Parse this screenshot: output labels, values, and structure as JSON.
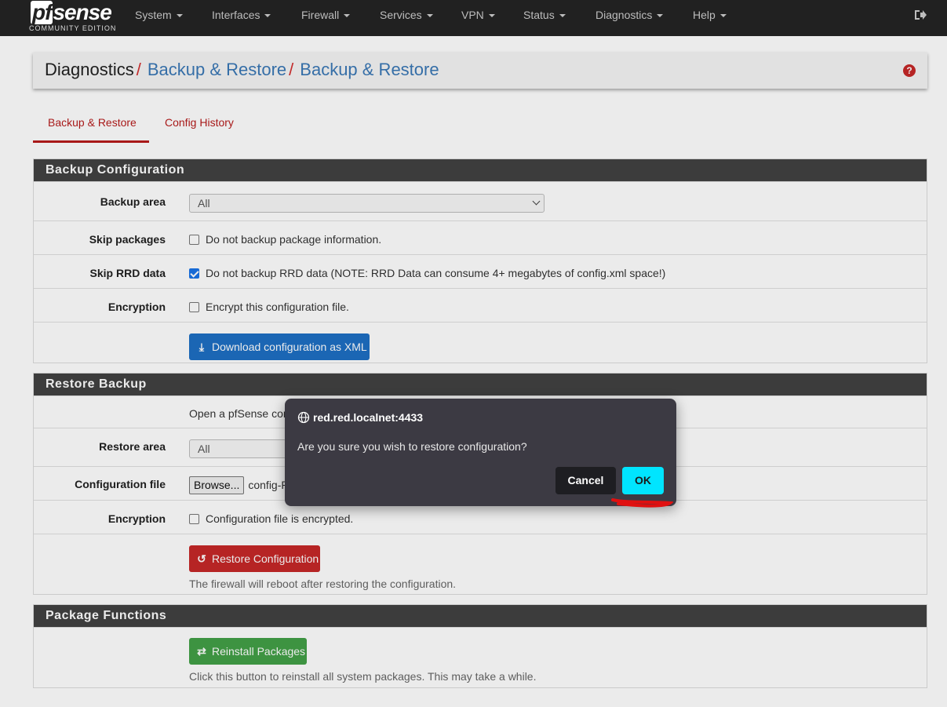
{
  "navbar": {
    "logo_main": "sense",
    "logo_pf": "pf",
    "logo_sub": "COMMUNITY EDITION",
    "items": [
      "System",
      "Interfaces",
      "Firewall",
      "Services",
      "VPN",
      "Status",
      "Diagnostics",
      "Help"
    ]
  },
  "breadcrumb": {
    "first": "Diagnostics",
    "separator": "/",
    "second": "Backup & Restore",
    "third": "Backup & Restore"
  },
  "help_icon": "?",
  "tabs": [
    {
      "label": "Backup & Restore",
      "active": true
    },
    {
      "label": "Config History",
      "active": false
    }
  ],
  "backup": {
    "heading": "Backup Configuration",
    "area_label": "Backup area",
    "area_value": "All",
    "skip_packages_label": "Skip packages",
    "skip_packages_text": "Do not backup package information.",
    "skip_packages_checked": false,
    "skip_rrd_label": "Skip RRD data",
    "skip_rrd_text": "Do not backup RRD data (NOTE: RRD Data can consume 4+ megabytes of config.xml space!)",
    "skip_rrd_checked": true,
    "encryption_label": "Encryption",
    "encryption_text": "Encrypt this configuration file.",
    "encryption_checked": false,
    "download_button": "Download configuration as XML"
  },
  "restore": {
    "heading": "Restore Backup",
    "intro_text": "Open a pfSense con",
    "area_label": "Restore area",
    "area_value": "All",
    "file_label": "Configuration file",
    "browse_button": "Browse...",
    "file_name": "config-R",
    "encryption_label": "Encryption",
    "encryption_text": "Configuration file is encrypted.",
    "encryption_checked": false,
    "restore_button": "Restore Configuration",
    "help": "The firewall will reboot after restoring the configuration."
  },
  "packages": {
    "heading": "Package Functions",
    "reinstall_button": "Reinstall Packages",
    "help": "Click this button to reinstall all system packages. This may take a while."
  },
  "dialog": {
    "origin": "red.red.localnet:4433",
    "message": "Are you sure you wish to restore configuration?",
    "cancel": "Cancel",
    "ok": "OK"
  },
  "colors": {
    "navbar": "#212121",
    "accent_red": "#b71c1c",
    "link_blue": "#3a78b6",
    "panel_heading": "#424242",
    "ok_button": "#00e5ff",
    "dialog_bg": "#3c3a43"
  }
}
